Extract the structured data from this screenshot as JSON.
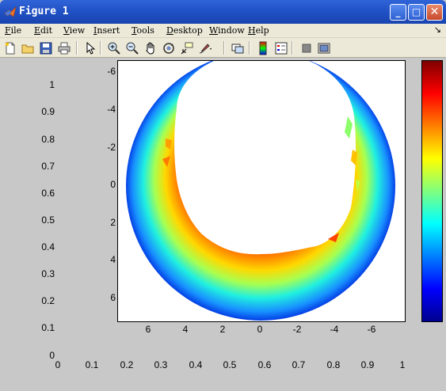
{
  "window": {
    "title": "Figure 1",
    "buttons": {
      "minimize": "_",
      "maximize": "□",
      "close": "✕"
    },
    "title_bar_color": "#245edb"
  },
  "menu": {
    "items": [
      "File",
      "Edit",
      "View",
      "Insert",
      "Tools",
      "Desktop",
      "Window",
      "Help"
    ],
    "overflow_arrow": "↘"
  },
  "toolbar": {
    "tools": [
      {
        "name": "new-figure",
        "icon": "new-file-icon"
      },
      {
        "name": "open-file",
        "icon": "folder-icon"
      },
      {
        "name": "save-figure",
        "icon": "save-icon"
      },
      {
        "name": "print-figure",
        "icon": "printer-icon"
      },
      {
        "name": "edit-plot",
        "icon": "pointer-icon"
      },
      {
        "name": "zoom-in",
        "icon": "zoom-in-icon"
      },
      {
        "name": "zoom-out",
        "icon": "zoom-out-icon"
      },
      {
        "name": "pan",
        "icon": "hand-icon"
      },
      {
        "name": "rotate-3d",
        "icon": "rotate-icon"
      },
      {
        "name": "data-cursor",
        "icon": "data-cursor-icon"
      },
      {
        "name": "brush",
        "icon": "brush-icon"
      },
      {
        "name": "link-plot",
        "icon": "link-icon"
      },
      {
        "name": "insert-colorbar",
        "icon": "colorbar-icon"
      },
      {
        "name": "insert-legend",
        "icon": "legend-icon"
      },
      {
        "name": "hide-plot-tools",
        "icon": "hide-tools-icon"
      },
      {
        "name": "show-plot-tools",
        "icon": "show-tools-icon"
      }
    ]
  },
  "figure": {
    "background_axes": {
      "y_ticks": [
        "1",
        "0.9",
        "0.8",
        "0.7",
        "0.6",
        "0.5",
        "0.4",
        "0.3",
        "0.2",
        "0.1",
        "0"
      ],
      "x_ticks": [
        "0",
        "0.1",
        "0.2",
        "0.3",
        "0.4",
        "0.5",
        "0.6",
        "0.7",
        "0.8",
        "0.9",
        "1"
      ]
    },
    "plot_axes": {
      "y_ticks": [
        "-6",
        "-4",
        "-2",
        "0",
        "2",
        "4",
        "6"
      ],
      "x_ticks": [
        "6",
        "4",
        "2",
        "0",
        "-2",
        "-4",
        "-6"
      ]
    },
    "colormap": "jet",
    "colorbar": "right"
  },
  "chart_data": {
    "type": "heatmap",
    "title": "",
    "xlabel": "",
    "ylabel": "",
    "xlim": [
      7.5,
      -7.5
    ],
    "ylim": [
      -6.5,
      7.3
    ],
    "x_reversed": true,
    "y_reversed": true,
    "colormap": "jet",
    "colorbar": true,
    "description_shape": "annular ring, outer radius about 7, with the inner hole edge about 4 on the +y side; values highest (red) on +y side next to the hole, lowest (blue) at outer rim"
  }
}
